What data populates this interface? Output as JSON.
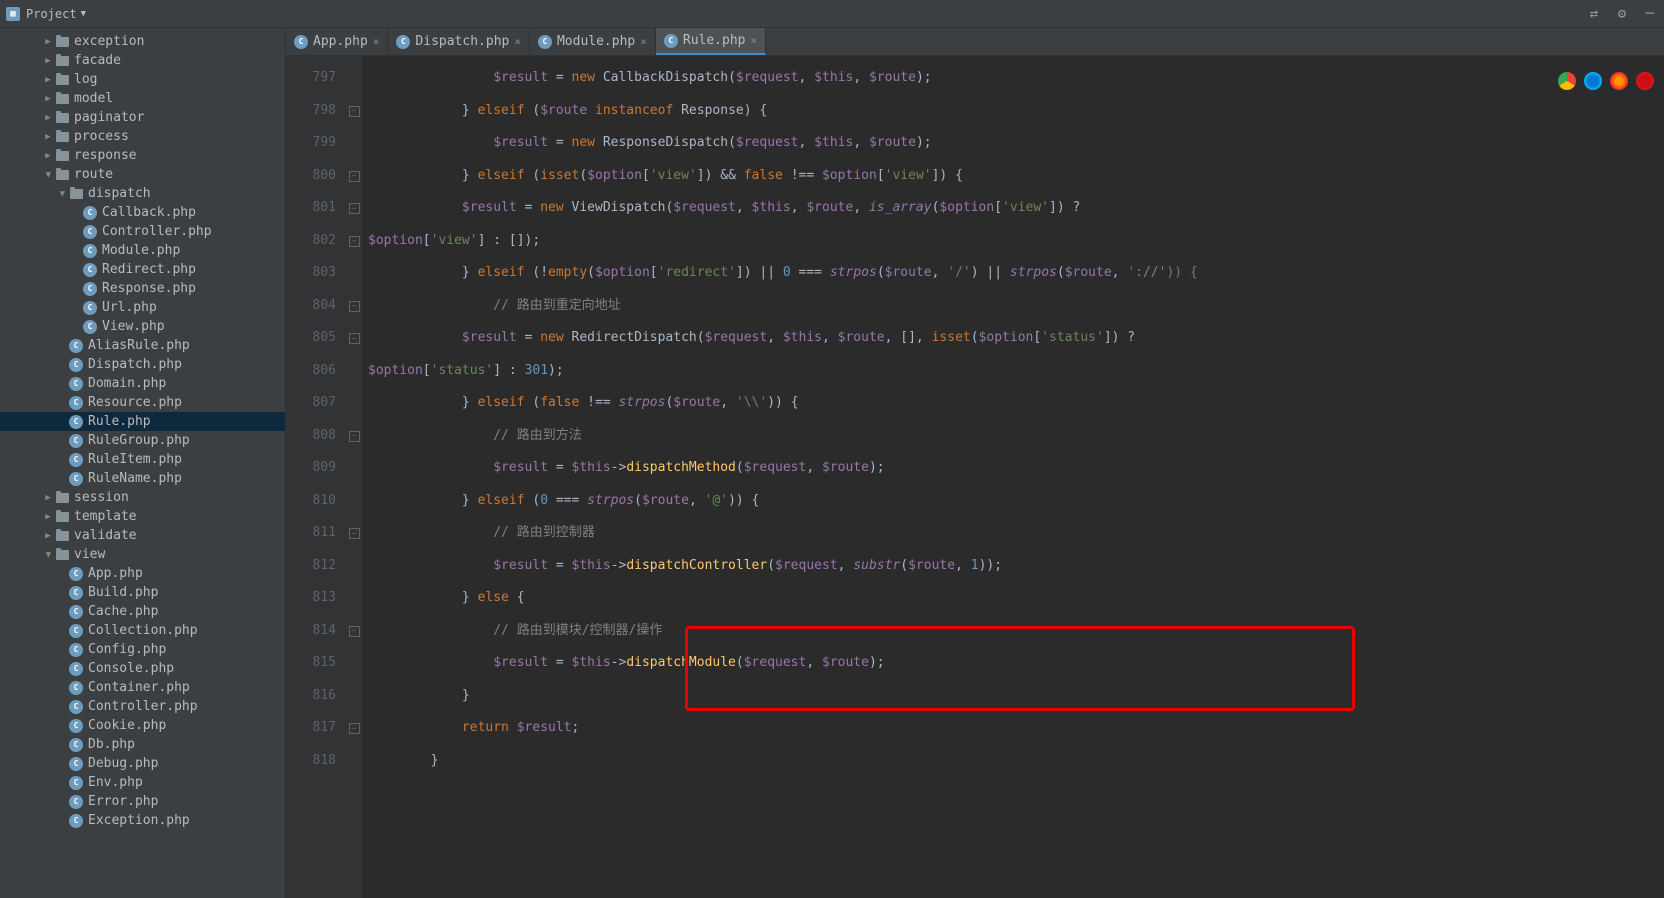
{
  "toolbar": {
    "project_label": "Project"
  },
  "tabs": [
    {
      "label": "App.php",
      "active": false
    },
    {
      "label": "Dispatch.php",
      "active": false
    },
    {
      "label": "Module.php",
      "active": false
    },
    {
      "label": "Rule.php",
      "active": true
    }
  ],
  "tree": {
    "folders_l1": [
      "exception",
      "facade",
      "log",
      "model",
      "paginator",
      "process",
      "response"
    ],
    "route": {
      "label": "route",
      "open": true
    },
    "dispatch": {
      "label": "dispatch",
      "open": true,
      "files": [
        "Callback.php",
        "Controller.php",
        "Module.php",
        "Redirect.php",
        "Response.php",
        "Url.php",
        "View.php"
      ]
    },
    "route_files": [
      "AliasRule.php",
      "Dispatch.php",
      "Domain.php",
      "Resource.php",
      "Rule.php",
      "RuleGroup.php",
      "RuleItem.php",
      "RuleName.php"
    ],
    "folders_l1_after": [
      "session",
      "template",
      "validate"
    ],
    "view": {
      "label": "view",
      "open": true,
      "files": [
        "App.php",
        "Build.php",
        "Cache.php",
        "Collection.php",
        "Config.php",
        "Console.php",
        "Container.php",
        "Controller.php",
        "Cookie.php",
        "Db.php",
        "Debug.php",
        "Env.php",
        "Error.php",
        "Exception.php"
      ]
    }
  },
  "code": {
    "line_start": 797,
    "lines": [
      {
        "n": 797,
        "t": "                $result = new CallbackDispatch($request, $this, $route);"
      },
      {
        "n": 798,
        "t": "            } elseif ($route instanceof Response) {"
      },
      {
        "n": 799,
        "t": "                $result = new ResponseDispatch($request, $this, $route);"
      },
      {
        "n": 800,
        "t": "            } elseif (isset($option['view']) && false !== $option['view']) {"
      },
      {
        "n": 801,
        "t": "                $result = new ViewDispatch($request, $this, $route, is_array($option['view']) ? $option['view'] : []);"
      },
      {
        "n": 802,
        "t": "            } elseif (!empty($option['redirect']) || 0 === strpos($route, '/') || strpos($route, '://')) {"
      },
      {
        "n": 803,
        "t": "                // 路由到重定向地址"
      },
      {
        "n": 804,
        "t": "                $result = new RedirectDispatch($request, $this, $route, [], isset($option['status']) ? $option['status'] : 301);"
      },
      {
        "n": 805,
        "t": "            } elseif (false !== strpos($route, '\\\\')) {"
      },
      {
        "n": 806,
        "t": "                // 路由到方法"
      },
      {
        "n": 807,
        "t": "                $result = $this->dispatchMethod($request, $route);"
      },
      {
        "n": 808,
        "t": "            } elseif (0 === strpos($route, '@')) {"
      },
      {
        "n": 809,
        "t": "                // 路由到控制器"
      },
      {
        "n": 810,
        "t": "                $result = $this->dispatchController($request, substr($route, 1));"
      },
      {
        "n": 811,
        "t": "            } else {"
      },
      {
        "n": 812,
        "t": "                // 路由到模块/控制器/操作"
      },
      {
        "n": 813,
        "t": "                $result = $this->dispatchModule($request, $route);"
      },
      {
        "n": 814,
        "t": "            }"
      },
      {
        "n": 815,
        "t": ""
      },
      {
        "n": 816,
        "t": "            return $result;"
      },
      {
        "n": 817,
        "t": "        }"
      },
      {
        "n": 818,
        "t": ""
      }
    ]
  },
  "selected_file": "Rule.php"
}
